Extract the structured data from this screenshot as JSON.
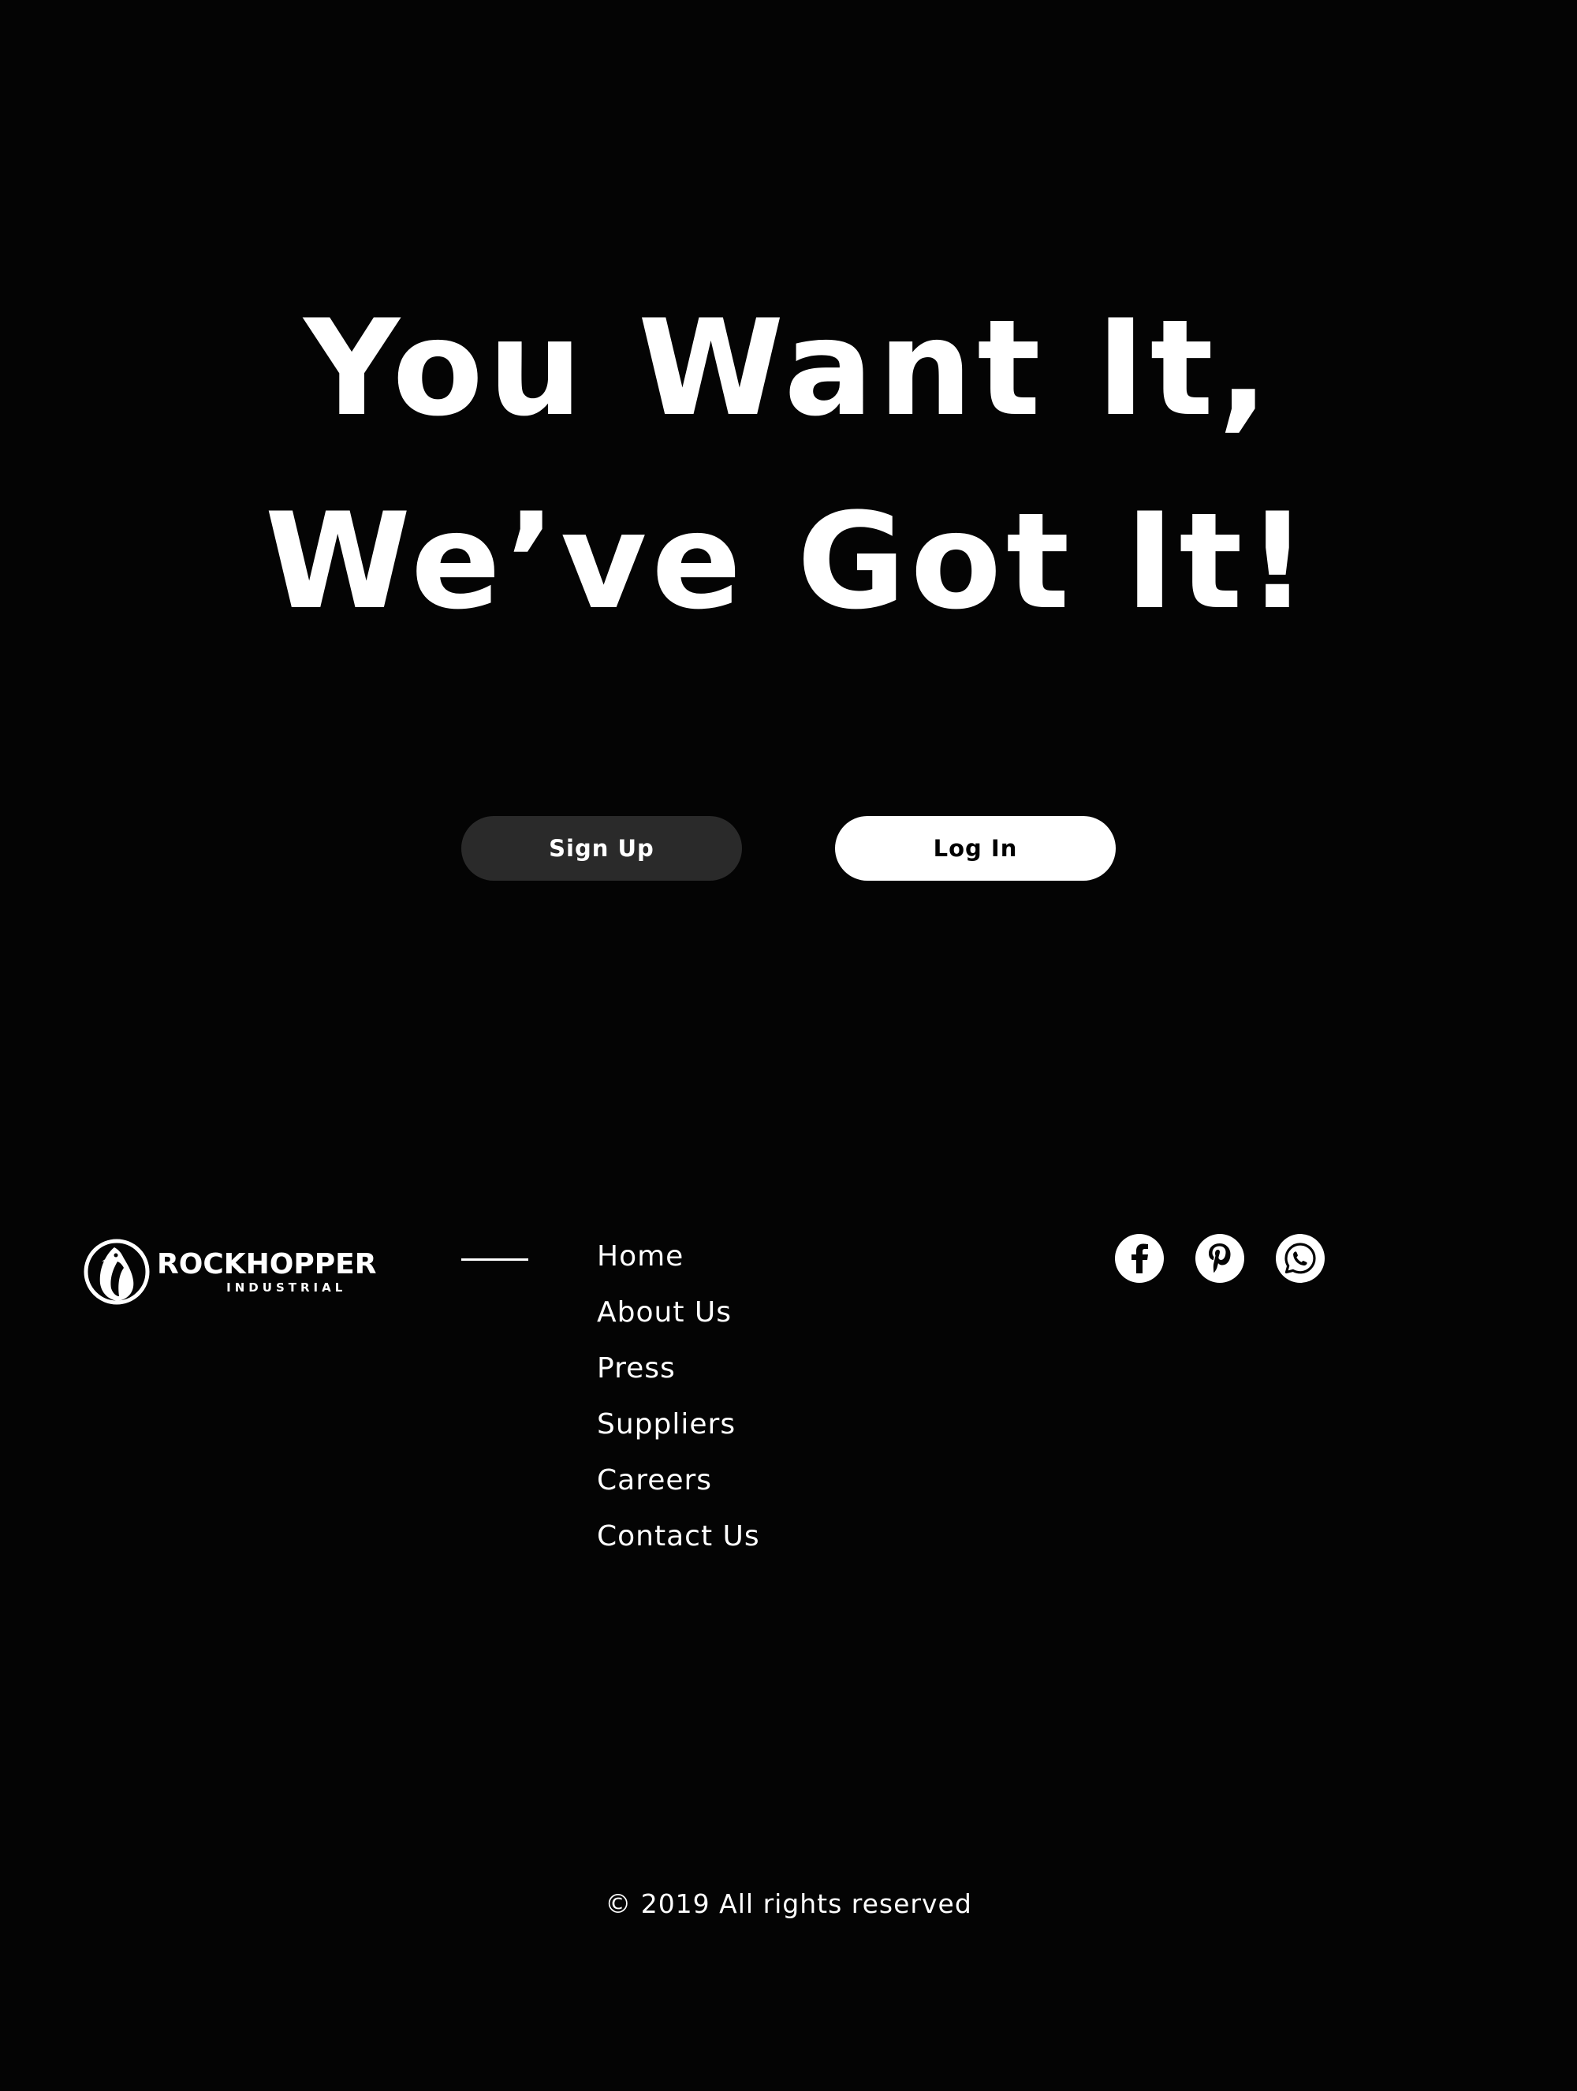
{
  "hero": {
    "line1": "You Want It,",
    "line2": "We’ve Got It!"
  },
  "buttons": {
    "signup_label": "Sign Up",
    "login_label": "Log In"
  },
  "logo": {
    "name": "ROCKHOPPER",
    "tagline": "INDUSTRIAL"
  },
  "footer": {
    "nav": [
      "Home",
      "About Us",
      "Press",
      "Suppliers",
      "Careers",
      "Contact Us"
    ],
    "social_icons": [
      "facebook-icon",
      "pinterest-icon",
      "whatsapp-icon"
    ],
    "copyright": "© 2019 All rights reserved"
  },
  "colors": {
    "background": "#040404",
    "text": "#ffffff",
    "signup_button": "#2a2a2a",
    "login_button": "#ffffff"
  }
}
